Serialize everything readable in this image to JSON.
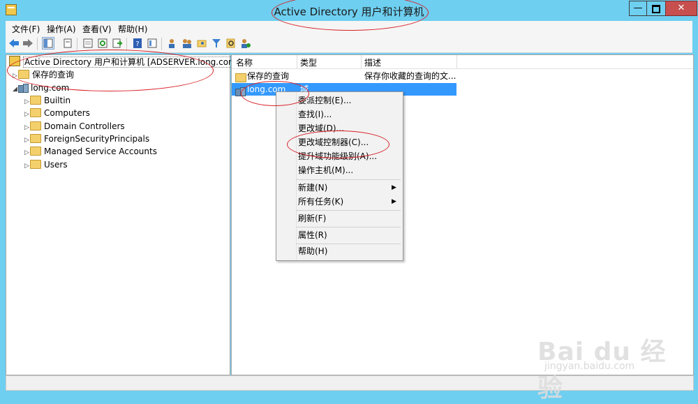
{
  "window": {
    "title": "Active Directory 用户和计算机",
    "minimize": "—",
    "close": "✕"
  },
  "menu": [
    "文件(F)",
    "操作(A)",
    "查看(V)",
    "帮助(H)"
  ],
  "toolbar": {
    "icons": [
      "back-icon",
      "forward-icon",
      "show-tree-icon",
      "console-icon",
      "properties-icon",
      "refresh-icon",
      "export-icon",
      "help-icon",
      "view-icon",
      "user-icon",
      "group-icon",
      "ou-icon",
      "filter-icon",
      "find-icon",
      "delegate-icon"
    ]
  },
  "tree": {
    "root": "Active Directory 用户和计算机 [ADSERVER.long.com]",
    "saved_queries": "保存的查询",
    "domain": "long.com",
    "children": [
      "Builtin",
      "Computers",
      "Domain Controllers",
      "ForeignSecurityPrincipals",
      "Managed Service Accounts",
      "Users"
    ]
  },
  "list": {
    "columns": [
      "名称",
      "类型",
      "描述"
    ],
    "rows": [
      {
        "name": "保存的查询",
        "type": "",
        "desc": "保存你收藏的查询的文..."
      },
      {
        "name": "long.com",
        "type": "域",
        "desc": ""
      }
    ]
  },
  "context_menu": {
    "items": [
      "委派控制(E)...",
      "查找(I)...",
      "更改域(D)...",
      "更改域控制器(C)...",
      "提升域功能级别(A)...",
      "操作主机(M)..."
    ],
    "new": "新建(N)",
    "all_tasks": "所有任务(K)",
    "refresh": "刷新(F)",
    "properties": "属性(R)",
    "help": "帮助(H)"
  },
  "watermark": {
    "logo": "Bai du 经验",
    "url": "jingyan.baidu.com"
  },
  "colors": {
    "titlebar": "#6ecff0",
    "selection": "#3399ff",
    "annotation": "#d81f26"
  }
}
